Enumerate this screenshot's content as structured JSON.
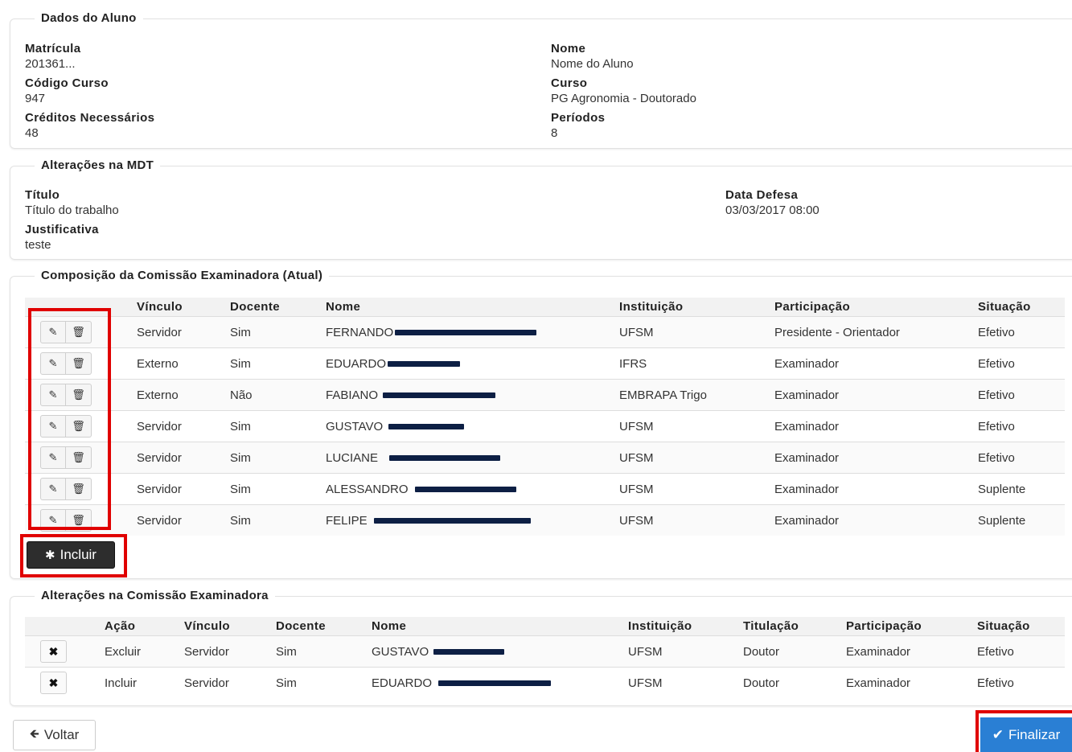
{
  "dados_aluno": {
    "legend": "Dados do Aluno",
    "matricula_label": "Matrícula",
    "matricula_value": "201361...",
    "nome_label": "Nome",
    "nome_value": "Nome do Aluno",
    "codigo_curso_label": "Código Curso",
    "codigo_curso_value": "947",
    "curso_label": "Curso",
    "curso_value": "PG Agronomia - Doutorado",
    "creditos_label": "Créditos Necessários",
    "creditos_value": "48",
    "periodos_label": "Períodos",
    "periodos_value": "8"
  },
  "alteracoes_mdt": {
    "legend": "Alterações na MDT",
    "titulo_label": "Título",
    "titulo_value": "Título do trabalho",
    "data_defesa_label": "Data Defesa",
    "data_defesa_value": "03/03/2017 08:00",
    "justificativa_label": "Justificativa",
    "justificativa_value": "teste"
  },
  "comissao_atual": {
    "legend": "Composição da Comissão Examinadora (Atual)",
    "headers": [
      "Vínculo",
      "Docente",
      "Nome",
      "Instituição",
      "Participação",
      "Situação"
    ],
    "rows": [
      {
        "vinculo": "Servidor",
        "docente": "Sim",
        "nome": "FERNANDO",
        "instituicao": "UFSM",
        "participacao": "Presidente - Orientador",
        "situacao": "Efetivo"
      },
      {
        "vinculo": "Externo",
        "docente": "Sim",
        "nome": "EDUARDO",
        "instituicao": "IFRS",
        "participacao": "Examinador",
        "situacao": "Efetivo"
      },
      {
        "vinculo": "Externo",
        "docente": "Não",
        "nome": "FABIANO",
        "instituicao": "EMBRAPA Trigo",
        "participacao": "Examinador",
        "situacao": "Efetivo"
      },
      {
        "vinculo": "Servidor",
        "docente": "Sim",
        "nome": "GUSTAVO",
        "instituicao": "UFSM",
        "participacao": "Examinador",
        "situacao": "Efetivo"
      },
      {
        "vinculo": "Servidor",
        "docente": "Sim",
        "nome": "LUCIANE",
        "instituicao": "UFSM",
        "participacao": "Examinador",
        "situacao": "Efetivo"
      },
      {
        "vinculo": "Servidor",
        "docente": "Sim",
        "nome": "ALESSANDRO",
        "instituicao": "UFSM",
        "participacao": "Examinador",
        "situacao": "Suplente"
      },
      {
        "vinculo": "Servidor",
        "docente": "Sim",
        "nome": "FELIPE",
        "instituicao": "UFSM",
        "participacao": "Examinador",
        "situacao": "Suplente"
      }
    ],
    "incluir_label": "Incluir"
  },
  "alteracoes_comissao": {
    "legend": "Alterações na Comissão Examinadora",
    "headers": [
      "Ação",
      "Vínculo",
      "Docente",
      "Nome",
      "Instituição",
      "Titulação",
      "Participação",
      "Situação"
    ],
    "rows": [
      {
        "acao": "Excluir",
        "vinculo": "Servidor",
        "docente": "Sim",
        "nome": "GUSTAVO",
        "instituicao": "UFSM",
        "titulacao": "Doutor",
        "participacao": "Examinador",
        "situacao": "Efetivo"
      },
      {
        "acao": "Incluir",
        "vinculo": "Servidor",
        "docente": "Sim",
        "nome": "EDUARDO",
        "instituicao": "UFSM",
        "titulacao": "Doutor",
        "participacao": "Examinador",
        "situacao": "Efetivo"
      }
    ]
  },
  "footer": {
    "voltar_label": "Voltar",
    "finalizar_label": "Finalizar"
  },
  "icons": {
    "edit": "edit-icon",
    "delete": "trash-icon",
    "remove": "x-icon",
    "incluir": "asterisk-icon",
    "voltar": "arrow-left-icon",
    "finalizar": "check-icon"
  },
  "colors": {
    "highlight": "#e00000",
    "primary": "#2a7fd4",
    "dark_button": "#2d2d2d",
    "redaction": "#0d1f44"
  }
}
